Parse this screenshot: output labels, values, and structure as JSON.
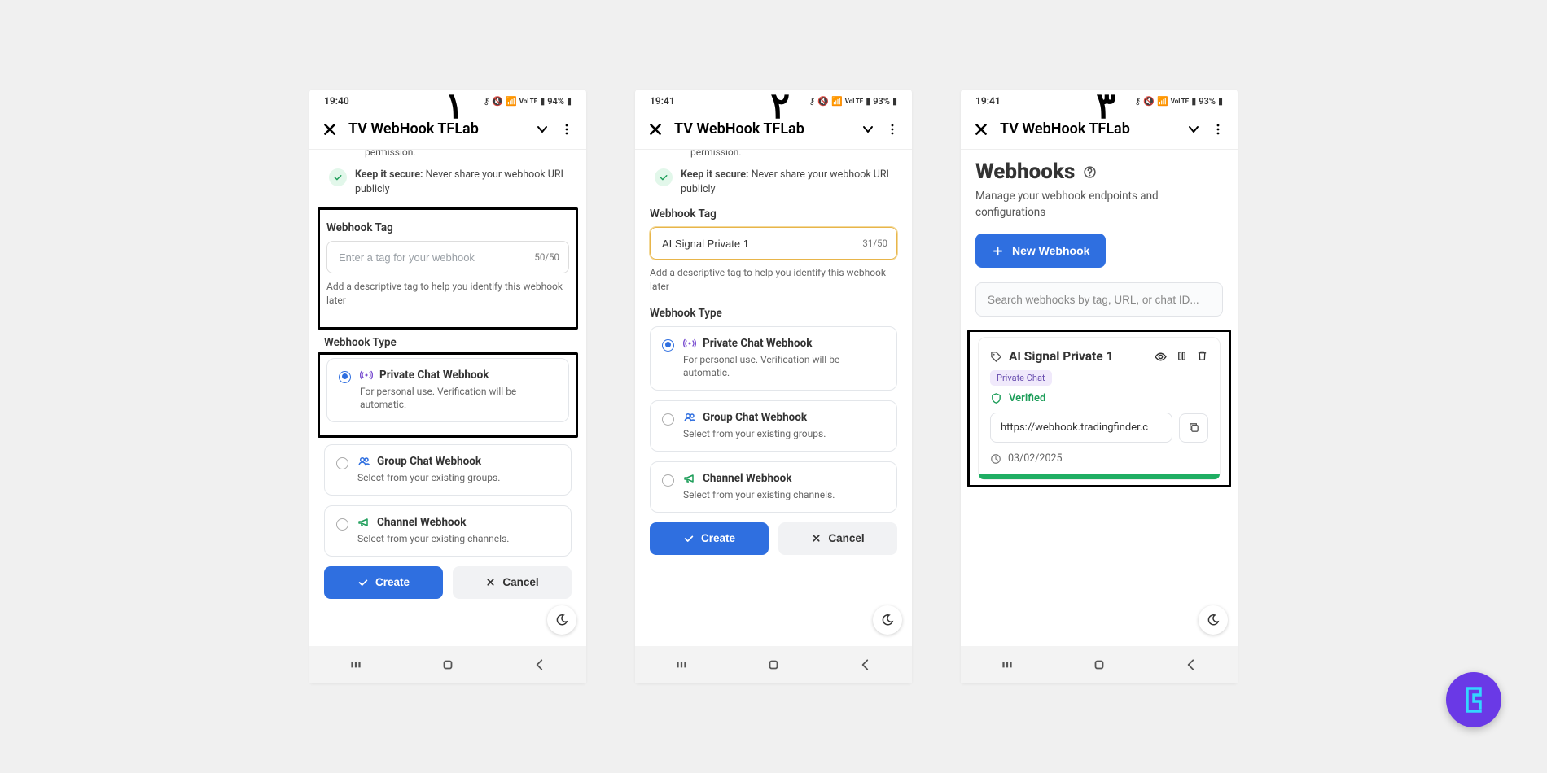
{
  "global": {
    "app_title": "TV WebHook TFLab",
    "step_labels": [
      "۱",
      "۲",
      "۳"
    ]
  },
  "status": {
    "time_1": "19:40",
    "time_2": "19:41",
    "time_3": "19:41",
    "batt_1": "94%",
    "batt_2": "93%",
    "batt_3": "93%"
  },
  "tips": {
    "partial_end": "permission.",
    "secure_label": "Keep it secure:",
    "secure_text": " Never share your webhook URL publicly"
  },
  "tag_section": {
    "label": "Webhook Tag",
    "placeholder": "Enter a tag for your webhook",
    "counter_empty": "50/50",
    "value_filled": "AI Signal Private 1",
    "counter_filled": "31/50",
    "helper": "Add a descriptive tag to help you identify this webhook later"
  },
  "type_section": {
    "label": "Webhook Type",
    "private_title": "Private Chat Webhook",
    "private_desc": "For personal use. Verification will be automatic.",
    "group_title": "Group Chat Webhook",
    "group_desc": "Select from your existing groups.",
    "channel_title": "Channel Webhook",
    "channel_desc": "Select from your existing channels."
  },
  "buttons": {
    "create": "Create",
    "cancel": "Cancel"
  },
  "webhooks_page": {
    "title": "Webhooks",
    "subtitle": "Manage your webhook endpoints and configurations",
    "new_button": "New Webhook",
    "search_placeholder": "Search webhooks by tag, URL, or chat ID...",
    "card_title": "AI Signal Private 1",
    "badge": "Private Chat",
    "verified": "Verified",
    "url": "https://webhook.tradingfinder.c",
    "date": "03/02/2025"
  }
}
